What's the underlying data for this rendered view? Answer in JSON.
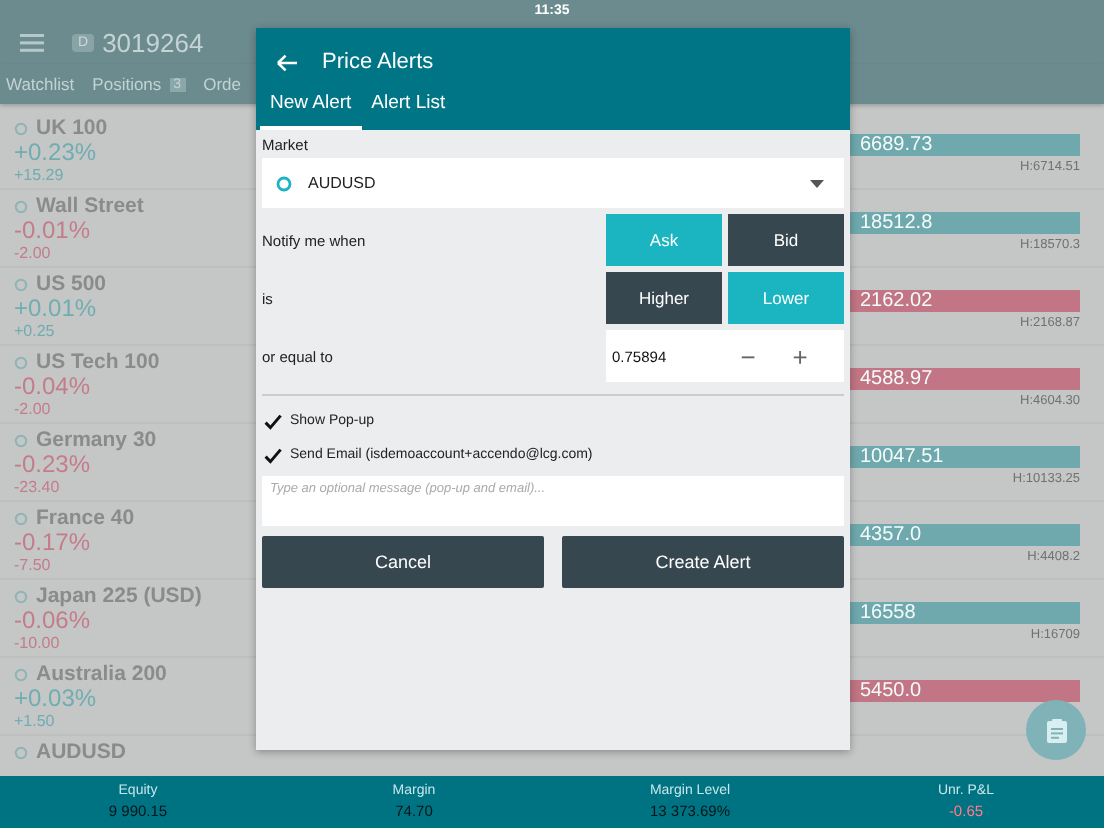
{
  "status_bar": {
    "time": "11:35"
  },
  "header": {
    "account_badge": "D",
    "account": "3019264"
  },
  "nav_tabs": [
    {
      "label": "Watchlist",
      "selected": false
    },
    {
      "label": "Positions",
      "badge": "3",
      "selected": false
    },
    {
      "label": "Orde",
      "selected": false
    }
  ],
  "watchlist": [
    {
      "name": "UK 100",
      "change_pct": "+0.23%",
      "change": "+15.29",
      "rising": true,
      "price": "6689.73",
      "bar_rising": true,
      "high": "H:6714.51"
    },
    {
      "name": "Wall Street",
      "change_pct": "-0.01%",
      "change": "-2.00",
      "rising": false,
      "price": "18512.8",
      "bar_rising": true,
      "high": "H:18570.3"
    },
    {
      "name": "US 500",
      "change_pct": "+0.01%",
      "change": "+0.25",
      "rising": true,
      "price": "2162.02",
      "bar_rising": false,
      "high": "H:2168.87"
    },
    {
      "name": "US Tech 100",
      "change_pct": "-0.04%",
      "change": "-2.00",
      "rising": false,
      "price": "4588.97",
      "bar_rising": false,
      "high": "H:4604.30"
    },
    {
      "name": "Germany 30",
      "change_pct": "-0.23%",
      "change": "-23.40",
      "rising": false,
      "price": "10047.51",
      "bar_rising": true,
      "high": "H:10133.25"
    },
    {
      "name": "France 40",
      "change_pct": "-0.17%",
      "change": "-7.50",
      "rising": false,
      "price": "4357.0",
      "bar_rising": true,
      "high": "H:4408.2"
    },
    {
      "name": "Japan 225 (USD)",
      "change_pct": "-0.06%",
      "change": "-10.00",
      "rising": false,
      "price": "16558",
      "bar_rising": true,
      "high": "H:16709"
    },
    {
      "name": "Australia 200",
      "change_pct": "+0.03%",
      "change": "+1.50",
      "rising": true,
      "price": "5450.0",
      "bar_rising": false
    },
    {
      "name": "AUDUSD"
    }
  ],
  "dialog": {
    "title": "Price Alerts",
    "tabs": [
      {
        "label": "New Alert",
        "selected": true
      },
      {
        "label": "Alert List",
        "selected": false
      }
    ],
    "market_label": "Market",
    "market": "AUDUSD",
    "rows": [
      {
        "label": "Notify me when",
        "kind": "toggle",
        "options": [
          {
            "label": "Ask",
            "selected": true
          },
          {
            "label": "Bid",
            "selected": false
          }
        ]
      },
      {
        "label": "is",
        "kind": "toggle",
        "options": [
          {
            "label": "Higher",
            "selected": false
          },
          {
            "label": "Lower",
            "selected": true
          }
        ]
      },
      {
        "label": "or equal to",
        "kind": "stepper",
        "value": "0.75894",
        "minus": "−",
        "plus": "+"
      }
    ],
    "checkboxes": [
      {
        "label": "Show Pop-up",
        "checked": true
      },
      {
        "label": "Send Email (isdemoaccount+accendo@lcg.com)",
        "checked": true
      }
    ],
    "message_placeholder": "Type an optional message (pop-up and email)...",
    "buttons": [
      "Cancel",
      "Create Alert"
    ]
  },
  "footer": [
    {
      "label": "Equity",
      "value": "9 990.15",
      "negative": false
    },
    {
      "label": "Margin",
      "value": "74.70",
      "negative": false
    },
    {
      "label": "Margin Level",
      "value": "13 373.69%",
      "negative": false
    },
    {
      "label": "Unr. P&L",
      "value": "-0.65",
      "negative": true
    }
  ]
}
